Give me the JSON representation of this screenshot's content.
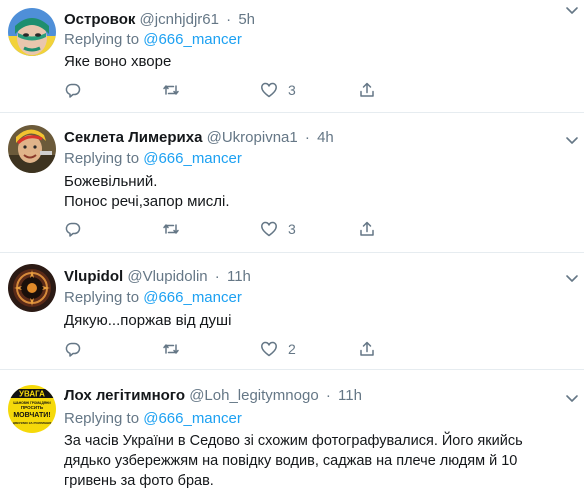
{
  "tweets": [
    {
      "display_name": "Островок",
      "handle": "@jcnhjdjr61",
      "separator": "·",
      "time": "5h",
      "reply_prefix": "Replying to",
      "reply_to": "@666_mancer",
      "lines": [
        "Яке воно хворе"
      ],
      "reply_count": "",
      "retweet_count": "",
      "like_count": "3",
      "avatar": "avatar-ostrovok"
    },
    {
      "display_name": "Секлета Лимериха",
      "handle": "@Ukropivna1",
      "separator": "·",
      "time": "4h",
      "reply_prefix": "Replying to",
      "reply_to": "@666_mancer",
      "lines": [
        "Божевільний.",
        "Понос речі,запор мислі."
      ],
      "reply_count": "",
      "retweet_count": "",
      "like_count": "3",
      "avatar": "avatar-sekleta"
    },
    {
      "display_name": "Vlupidol",
      "handle": "@Vlupidolin",
      "separator": "·",
      "time": "11h",
      "reply_prefix": "Replying to",
      "reply_to": "@666_mancer",
      "lines": [
        "Дякую...поржав від душі"
      ],
      "reply_count": "",
      "retweet_count": "",
      "like_count": "2",
      "avatar": "avatar-vlupidol"
    },
    {
      "display_name": "Лох легітимного",
      "handle": "@Loh_legitymnogo",
      "separator": "·",
      "time": "11h",
      "reply_prefix": "Replying to",
      "reply_to": "@666_mancer",
      "lines": [
        "За часів України в Седово зі схожим фотографувалися. Його якийсь",
        "дядько узбережжям на повідку водив, саджав на плече людям й 10",
        "гривень за фото брав."
      ],
      "avatar": "avatar-loh",
      "avatar_text": {
        "title": "УВАГА",
        "line1": "ШАНОВНІ ГРОМАДЯНИ",
        "line2": "ПРОСИТЬ",
        "line3": "МОВЧАТИ!",
        "line4": "ДЯКУЄМО ЗА РОЗУМІННЯ"
      }
    }
  ],
  "colors": {
    "name": "#14171a",
    "meta": "#657786",
    "link": "#1da1f2",
    "divider": "#e6ecf0",
    "avatar_badge_bg": "#f5d90a"
  },
  "icons": {
    "reply": "reply-icon",
    "retweet": "retweet-icon",
    "like": "like-icon",
    "share": "share-icon",
    "more": "chevron-down-icon"
  }
}
